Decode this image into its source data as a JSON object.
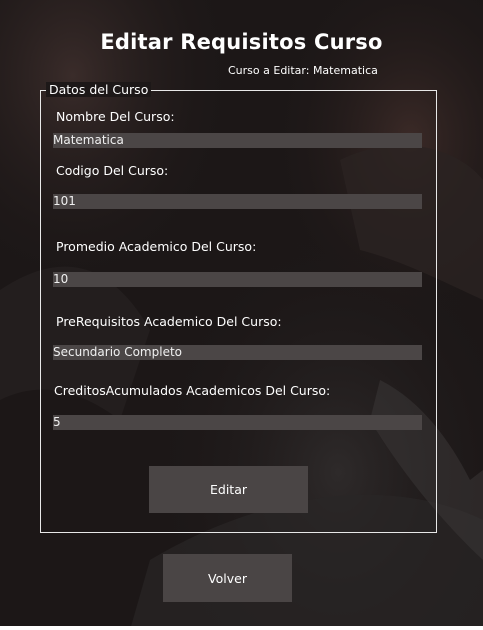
{
  "header": {
    "title": "Editar Requisitos Curso",
    "subtitle": "Curso a Editar: Matematica"
  },
  "form": {
    "group_label": "Datos del Curso",
    "fields": [
      {
        "label": "Nombre Del Curso:",
        "value": "Matematica"
      },
      {
        "label": "Codigo Del Curso:",
        "value": "101"
      },
      {
        "label": "Promedio Academico Del Curso:",
        "value": "10"
      },
      {
        "label": "PreRequisitos Academico Del Curso:",
        "value": "Secundario Completo"
      },
      {
        "label": "CreditosAcumulados Academicos Del Curso:",
        "value": "5"
      }
    ],
    "edit_label": "Editar"
  },
  "footer": {
    "back_label": "Volver"
  },
  "colors": {
    "background": "#1c1717",
    "field_bg": "#4b4646",
    "button_bg": "#4a4545",
    "text": "#ffffff"
  }
}
